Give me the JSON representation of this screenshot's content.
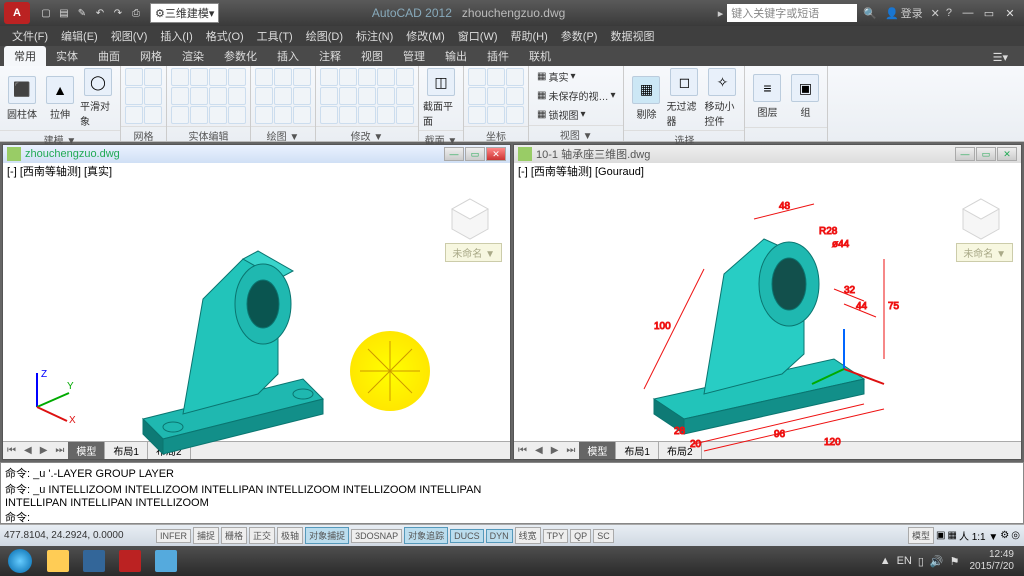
{
  "titlebar": {
    "logo": "A",
    "workspace": "三维建模",
    "app_name": "AutoCAD 2012",
    "doc_name": "zhouchengzuo.dwg",
    "search_placeholder": "键入关键字或短语",
    "login": "登录"
  },
  "menus": [
    "文件(F)",
    "编辑(E)",
    "视图(V)",
    "插入(I)",
    "格式(O)",
    "工具(T)",
    "绘图(D)",
    "标注(N)",
    "修改(M)",
    "窗口(W)",
    "帮助(H)",
    "参数(P)",
    "数据视图"
  ],
  "ribbon_tabs": [
    "常用",
    "实体",
    "曲面",
    "网格",
    "渲染",
    "参数化",
    "插入",
    "注释",
    "视图",
    "管理",
    "输出",
    "插件",
    "联机"
  ],
  "ribbon_active": "常用",
  "ribbon_panels": {
    "p1": {
      "label": "建模 ▼",
      "b1": "圆柱体",
      "b2": "拉伸",
      "b3": "平滑对象"
    },
    "p2": {
      "label": "网格"
    },
    "p3": {
      "label": "实体编辑"
    },
    "p4": {
      "label": "绘图 ▼"
    },
    "p5": {
      "label": "修改 ▼"
    },
    "p6": {
      "label": "截面 ▼",
      "b1": "截面平面"
    },
    "p7": {
      "label": "坐标"
    },
    "p8": {
      "label": "视图 ▼",
      "d1": "真实",
      "d2": "未保存的视…",
      "d3": "锁视图"
    },
    "p9": {
      "label": "选择",
      "b1": "剔除",
      "b2": "无过滤器",
      "b3": "移动小控件"
    },
    "p10": {
      "label": "",
      "b1": "图层",
      "b2": "组"
    }
  },
  "docs": {
    "left": {
      "title": "zhouchengzuo.dwg",
      "info": "[-] [西南等轴测] [真实]",
      "tag": "未命名 ▼",
      "tabs": [
        "模型",
        "布局1",
        "布局2"
      ],
      "active_tab": "模型"
    },
    "right": {
      "title": "10-1 轴承座三维图.dwg",
      "info": "[-] [西南等轴测] [Gouraud]",
      "tag": "未命名 ▼",
      "tabs": [
        "模型",
        "布局1",
        "布局2"
      ],
      "active_tab": "模型",
      "dims": {
        "d48": "48",
        "d100": "100",
        "d96": "96",
        "d120": "120",
        "d75": "75",
        "d32": "32",
        "d44": "44",
        "d28": "28",
        "d20": "20",
        "r28": "R28",
        "phi44": "ø44"
      }
    }
  },
  "cmd": {
    "l1": "命令: _u '.-LAYER GROUP LAYER",
    "l2": "命令: _u INTELLIZOOM INTELLIZOOM INTELLIPAN INTELLIZOOM INTELLIZOOM INTELLIPAN",
    "l3": "INTELLIPAN INTELLIPAN INTELLIZOOM",
    "l4": "命令:"
  },
  "status": {
    "coords": "477.8104, 24.2924, 0.0000",
    "toggles": [
      "INFER",
      "捕捉",
      "栅格",
      "正交",
      "极轴",
      "对象捕捉",
      "3DOSNAP",
      "对象追踪",
      "DUCS",
      "DYN",
      "线宽",
      "TPY",
      "QP",
      "SC"
    ],
    "on": [
      "对象捕捉",
      "对象追踪",
      "DUCS",
      "DYN"
    ],
    "model": "模型",
    "scale": "人 1:1 ▼"
  },
  "taskbar": {
    "lang": "EN",
    "time": "12:49",
    "date": "2015/7/20"
  }
}
